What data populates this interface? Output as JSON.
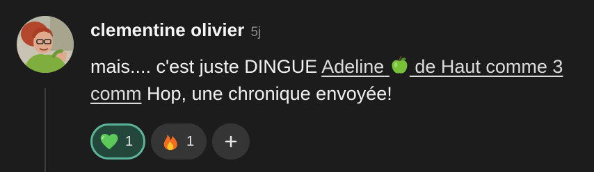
{
  "comment": {
    "author": "clementine olivier",
    "time": "5j",
    "text_before": "mais.... c'est juste DINGUE ",
    "mention_name": "Adeline",
    "mention_suffix": " de Haut comme 3 comm",
    "text_after": " Hop, une chronique envoyée!",
    "avatar_icon": "user-photo-avatar",
    "mention_emoji": "green-apple"
  },
  "reactions": [
    {
      "emoji": "green-heart",
      "count": "1",
      "active": true,
      "color": "#5bb49a"
    },
    {
      "emoji": "fire",
      "count": "1",
      "active": false
    }
  ],
  "add_reaction": {
    "icon": "plus-icon",
    "label": "+"
  },
  "colors": {
    "background": "#1c1c1c",
    "pill": "#353535",
    "active_pill_bg": "#24473c",
    "active_pill_border": "#5bb49a",
    "muted_text": "#8c8c8c"
  }
}
